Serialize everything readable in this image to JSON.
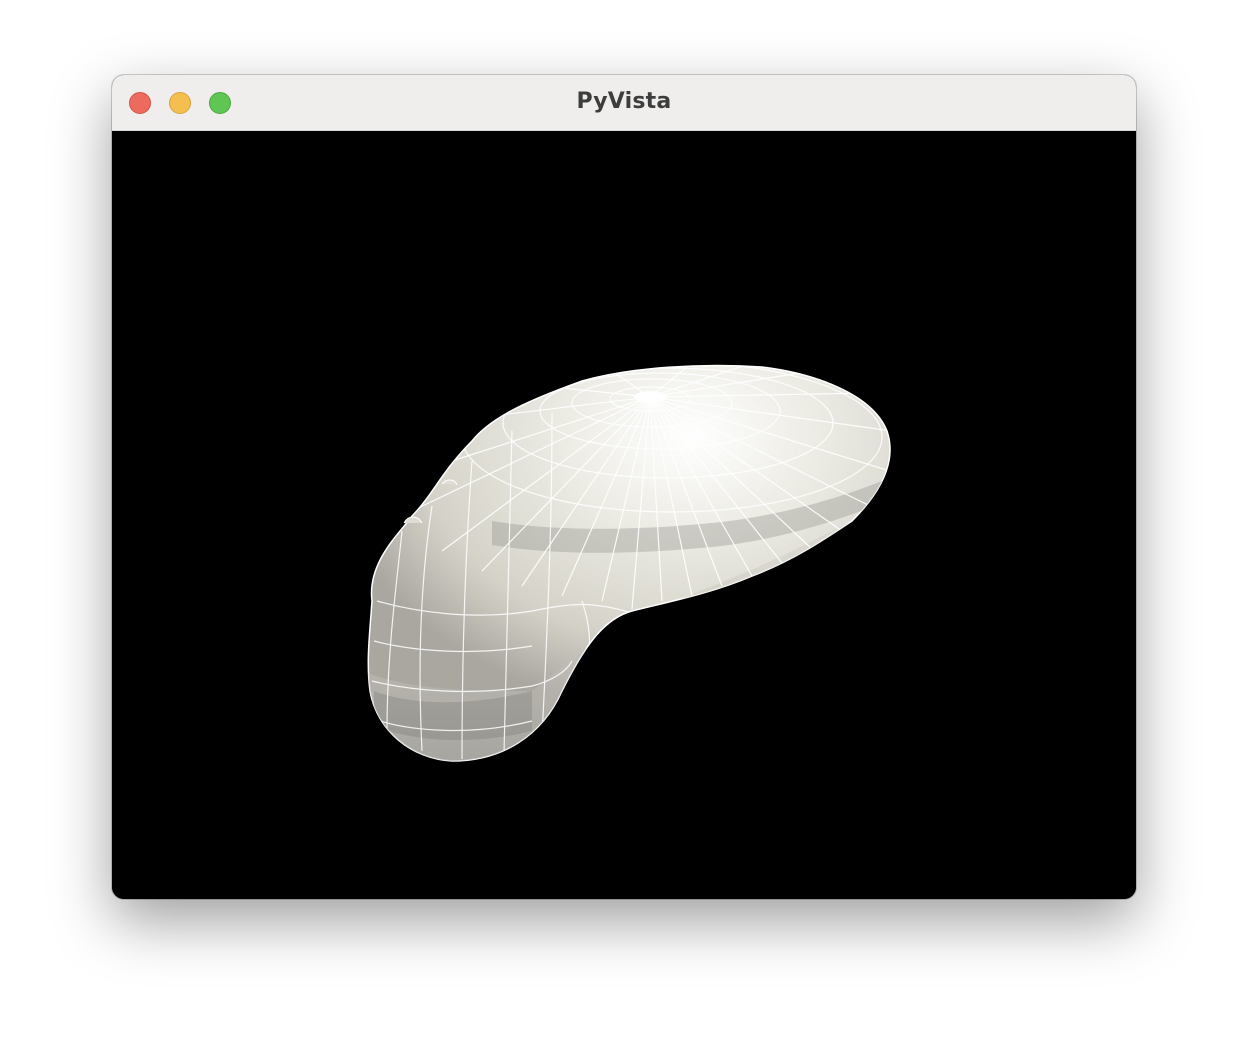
{
  "window": {
    "title": "PyVista"
  },
  "titlebar": {
    "buttons": [
      "close",
      "minimize",
      "zoom"
    ],
    "colors": {
      "close": "#ec6a5e",
      "minimize": "#f4bf4f",
      "zoom": "#61c554"
    }
  },
  "viewport": {
    "background": "#000000",
    "mesh_color": "#e6e4dc",
    "wireframe_color": "#ffffff",
    "object": "asteroid-mesh"
  }
}
